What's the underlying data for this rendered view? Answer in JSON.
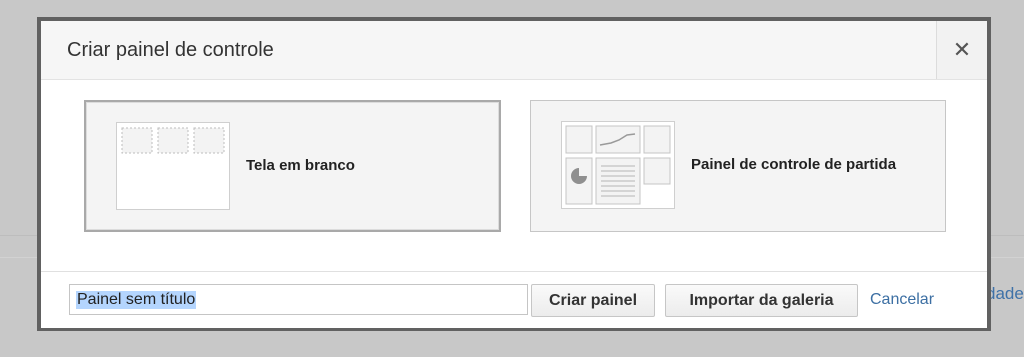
{
  "dialog": {
    "title": "Criar painel de controle",
    "close_glyph": "✕"
  },
  "options": [
    {
      "label": "Tela em branco",
      "icon": "blank-canvas-icon",
      "selected": true
    },
    {
      "label": "Painel de controle de partida",
      "icon": "starter-dashboard-icon",
      "selected": false
    }
  ],
  "footer": {
    "name_value": "Painel sem título",
    "create_label": "Criar painel",
    "import_label": "Importar da galeria",
    "cancel_label": "Cancelar"
  },
  "background": {
    "partial_text": "dade"
  },
  "colors": {
    "link": "#3c6fa3",
    "selection": "#b4d5fe",
    "dialog_border": "#616161"
  }
}
